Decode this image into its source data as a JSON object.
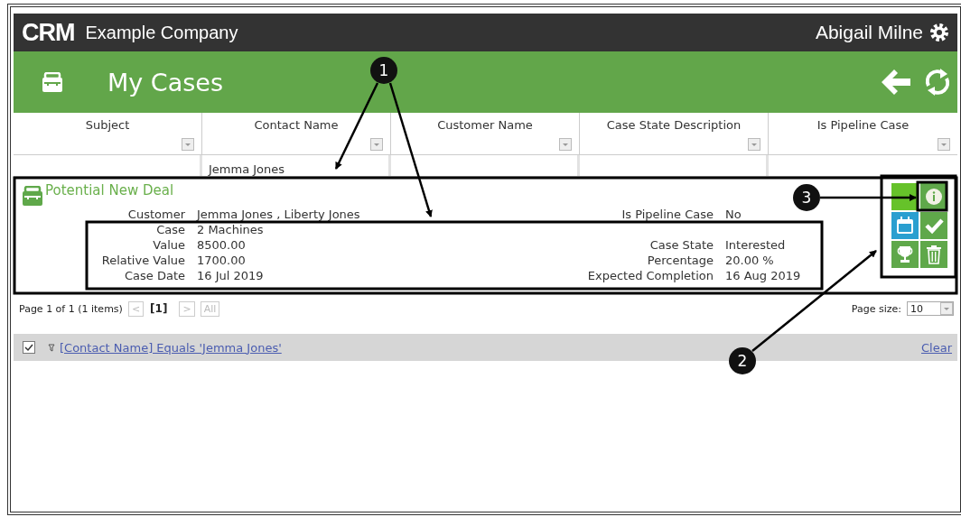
{
  "header": {
    "logo": "CRM",
    "company": "Example Company",
    "user": "Abigail Milne"
  },
  "title_bar": {
    "title": "My Cases"
  },
  "grid": {
    "columns": [
      {
        "label": "Subject"
      },
      {
        "label": "Contact Name",
        "filter": "Jemma Jones"
      },
      {
        "label": "Customer Name"
      },
      {
        "label": "Case State Description"
      },
      {
        "label": "Is Pipeline Case"
      }
    ]
  },
  "record": {
    "subject": "Potential New Deal",
    "rows": [
      {
        "left": {
          "label": "Customer",
          "value": "Jemma Jones , Liberty Jones"
        },
        "right": {
          "label": "Is Pipeline Case",
          "value": "No"
        }
      },
      {
        "left": {
          "label": "Case",
          "value": "2 Machines"
        }
      },
      {
        "left": {
          "label": "Value",
          "value": "8500.00"
        },
        "right": {
          "label": "Case State",
          "value": "Interested"
        }
      },
      {
        "left": {
          "label": "Relative Value",
          "value": "1700.00"
        },
        "right": {
          "label": "Percentage",
          "value": "20.00 %"
        }
      },
      {
        "left": {
          "label": "Case Date",
          "value": "16 Jul 2019"
        },
        "right": {
          "label": "Expected Completion",
          "value": "16 Aug 2019"
        }
      }
    ],
    "actions": [
      {
        "kind": "blank",
        "color": "#66c22a"
      },
      {
        "kind": "info",
        "color": "#5fa84a"
      },
      {
        "kind": "calendar",
        "color": "#2a9fd0"
      },
      {
        "kind": "check",
        "color": "#5fa84a"
      },
      {
        "kind": "trophy",
        "color": "#5fa84a"
      },
      {
        "kind": "delete",
        "color": "#5fa84a"
      }
    ]
  },
  "pager": {
    "summary": "Page 1 of 1 (1 items)",
    "buttons": [
      {
        "label": "<",
        "disabled": true
      },
      {
        "label": "[1]",
        "disabled": false
      },
      {
        "label": ">",
        "disabled": true
      },
      {
        "label": "All",
        "disabled": true
      }
    ],
    "page_size_label": "Page size:",
    "page_size": "10"
  },
  "filter_bar": {
    "checked": true,
    "expression": "[Contact Name] Equals 'Jemma Jones'",
    "clear": "Clear"
  },
  "callouts": [
    {
      "number": "1"
    },
    {
      "number": "2"
    },
    {
      "number": "3"
    }
  ]
}
